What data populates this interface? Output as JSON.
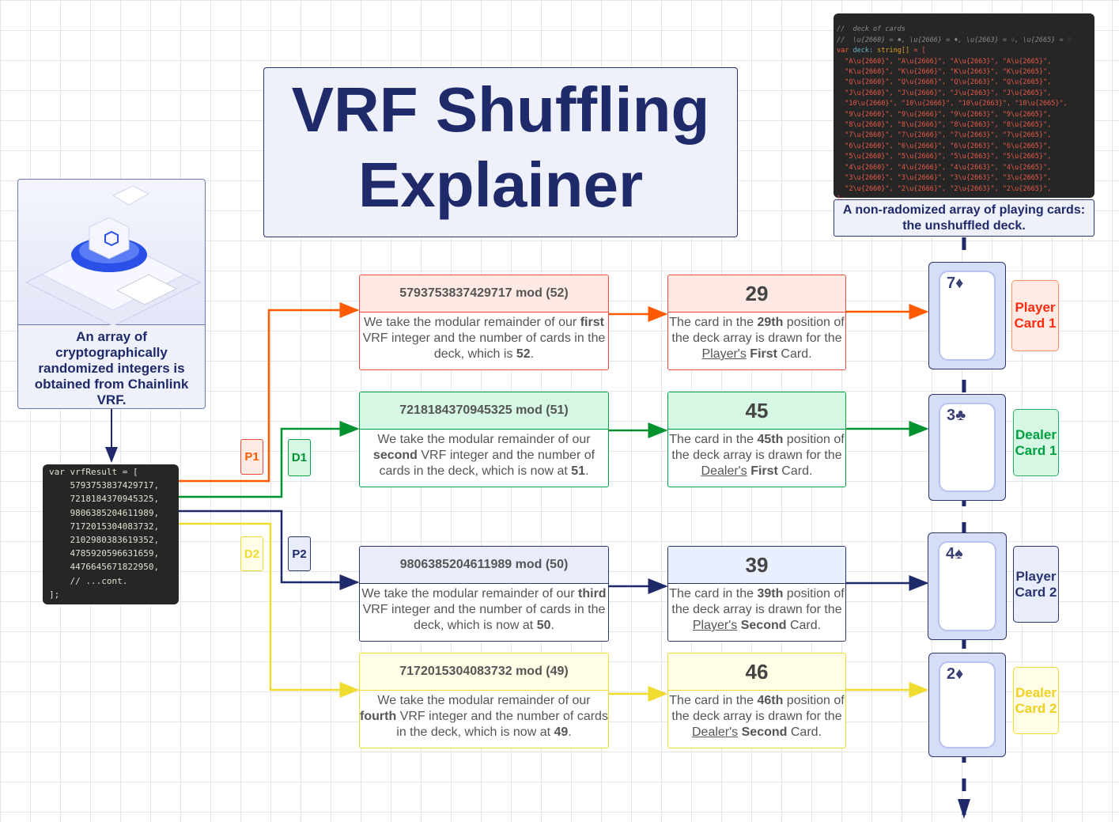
{
  "title": "VRF Shuffling Explainer",
  "intro_panel": {
    "text": "An array of cryptographically randomized integers is obtained from Chainlink VRF."
  },
  "vrf_code": {
    "lines": [
      "var vrfResult = [",
      "    5793753837429717,",
      "    7218184370945325,",
      "    9806385204611989,",
      "    7172015304083732,",
      "    2102980383619352,",
      "    4785920596631659,",
      "    4476645671822950,",
      "    // ...cont.",
      "];"
    ]
  },
  "deck_code": {
    "comment1": "//  deck of cards",
    "comment2": "//  \\u{2660} = ♠, \\u{2666} = ♦, \\u{2663} = ♧, \\u{2665} = ♡",
    "decl_kw": "var",
    "decl_name": "deck:",
    "decl_type": "string[]",
    "decl_rest": " = [",
    "rows": [
      "  \"A\\u{2660}\", \"A\\u{2666}\", \"A\\u{2663}\", \"A\\u{2665}\",",
      "  \"K\\u{2660}\", \"K\\u{2666}\", \"K\\u{2663}\", \"K\\u{2665}\",",
      "  \"Q\\u{2660}\", \"Q\\u{2666}\", \"Q\\u{2663}\", \"Q\\u{2665}\",",
      "  \"J\\u{2660}\", \"J\\u{2666}\", \"J\\u{2663}\", \"J\\u{2665}\",",
      "  \"10\\u{2660}\", \"10\\u{2666}\", \"10\\u{2663}\", \"10\\u{2665}\",",
      "  \"9\\u{2660}\", \"9\\u{2666}\", \"9\\u{2663}\", \"9\\u{2665}\",",
      "  \"8\\u{2660}\", \"8\\u{2666}\", \"8\\u{2663}\", \"8\\u{2665}\",",
      "  \"7\\u{2660}\", \"7\\u{2666}\", \"7\\u{2663}\", \"7\\u{2665}\",",
      "  \"6\\u{2660}\", \"6\\u{2666}\", \"6\\u{2663}\", \"6\\u{2665}\",",
      "  \"5\\u{2660}\", \"5\\u{2666}\", \"5\\u{2663}\", \"5\\u{2665}\",",
      "  \"4\\u{2660}\", \"4\\u{2666}\", \"4\\u{2663}\", \"4\\u{2665}\",",
      "  \"3\\u{2660}\", \"3\\u{2666}\", \"3\\u{2663}\", \"3\\u{2665}\",",
      "  \"2\\u{2660}\", \"2\\u{2666}\", \"2\\u{2663}\", \"2\\u{2665}\","
    ],
    "close": "];"
  },
  "deck_caption": "A non-radomized array of playing cards: the unshuffled deck.",
  "rows": [
    {
      "tag": "P1",
      "color": "#ff5a00",
      "border": "#f04a3a",
      "bg": "#ffe9e4",
      "mod": "5793753837429717 mod (52)",
      "mod_pre": "We take the modular remainder of our ",
      "ordinal": "first",
      "mod_mid": " VRF integer and the number of cards in the deck, which is ",
      "count": "52",
      "result": "29",
      "res_pre": "The card in the ",
      "pos": "29th",
      "res_mid": " position of the deck array is drawn for the ",
      "who": "Player's",
      "nth": "First",
      "res_end": " Card.",
      "card": "7♦",
      "label": "Player Card 1",
      "label_color": "#ff2a10",
      "label_bg": "#ffebe4",
      "label_border": "#ff9060"
    },
    {
      "tag": "D1",
      "color": "#00922e",
      "border": "#00a040",
      "bg": "#d6f7e4",
      "mod": "7218184370945325 mod (51)",
      "mod_pre": "We take the modular remainder of our ",
      "ordinal": "second",
      "mod_mid": " VRF integer and the number of cards in the deck, which is now at ",
      "count": "51",
      "result": "45",
      "res_pre": "The card in the ",
      "pos": "45th",
      "res_mid": " position of the deck array is drawn for the ",
      "who": "Dealer's",
      "nth": "First",
      "res_end": " Card.",
      "card": "3♣",
      "label": "Dealer Card 1",
      "label_color": "#00a040",
      "label_bg": "#d6f7e4",
      "label_border": "#30b060"
    },
    {
      "tag": "P2",
      "color": "#1f2a6b",
      "border": "#2b3570",
      "bg": "#e9edfb",
      "mod": "9806385204611989 mod (50)",
      "mod_pre": "We take the modular remainder of our ",
      "ordinal": "third",
      "mod_mid": " VRF integer and the number of cards in the deck, which is now at ",
      "count": "50",
      "result": "39",
      "res_pre": "The card in the ",
      "pos": "39th",
      "res_mid": " position of the deck array is drawn for the ",
      "who": "Player's",
      "nth": "Second",
      "res_end": " Card.",
      "card": "4♠",
      "label": "Player Card 2",
      "label_color": "#2b3570",
      "label_bg": "#e9edfb",
      "label_border": "#2b3570"
    },
    {
      "tag": "D2",
      "color": "#f0dc30",
      "border": "#f0dc30",
      "bg": "#fffde6",
      "mod": "7172015304083732 mod (49)",
      "mod_pre": "We take the modular remainder of our ",
      "ordinal": "fourth",
      "mod_mid": " VRF integer and the number of cards in the deck, which is now at ",
      "count": "49",
      "result": "46",
      "res_pre": "The card in the ",
      "pos": "46th",
      "res_mid": " position of the deck array is drawn for the ",
      "who": "Dealer's",
      "nth": "Second",
      "res_end": " Card.",
      "card": "2♦",
      "label": "Dealer Card 2",
      "label_color": "#f0d020",
      "label_bg": "#fffde6",
      "label_border": "#f0dc30"
    }
  ]
}
